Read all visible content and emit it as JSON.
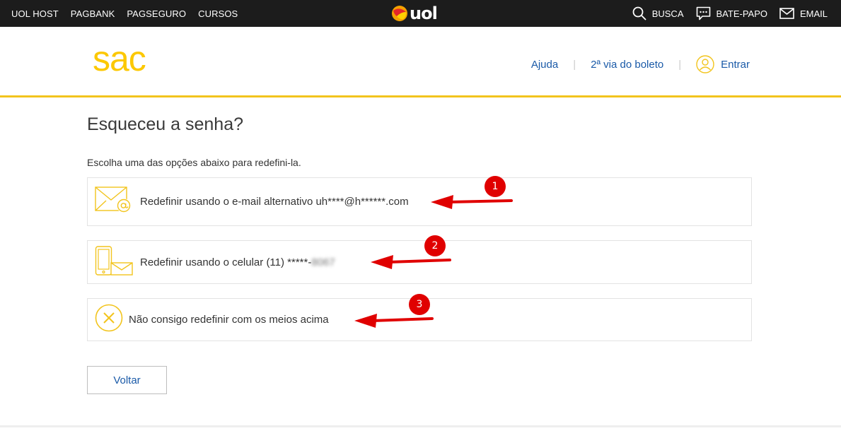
{
  "topbar": {
    "links": [
      "UOL HOST",
      "PAGBANK",
      "PAGSEGURO",
      "CURSOS"
    ],
    "logo": "uol",
    "right": [
      {
        "label": "BUSCA",
        "icon": "search-icon"
      },
      {
        "label": "BATE-PAPO",
        "icon": "chat-icon"
      },
      {
        "label": "EMAIL",
        "icon": "mail-icon"
      }
    ]
  },
  "header": {
    "brand": "sac",
    "nav": {
      "help": "Ajuda",
      "boleto": "2ª via do boleto",
      "login": "Entrar"
    }
  },
  "main": {
    "title": "Esqueceu a senha?",
    "subtitle": "Escolha uma das opções abaixo para redefini-la.",
    "options": [
      {
        "label": "Redefinir usando o e-mail alternativo uh****@h******.com",
        "icon": "email-at-icon"
      },
      {
        "label_prefix": "Redefinir usando o celular (11) *****-",
        "label_hidden": "8067",
        "icon": "phone-message-icon"
      },
      {
        "label": "Não consigo redefinir com os meios acima",
        "icon": "close-circle-icon"
      }
    ],
    "back_button": "Voltar"
  },
  "annotations": [
    "1",
    "2",
    "3"
  ],
  "colors": {
    "brand_yellow": "#fcc800",
    "link_blue": "#1a5aa8",
    "topbar_bg": "#1c1c1c",
    "annotation_red": "#e00000"
  }
}
